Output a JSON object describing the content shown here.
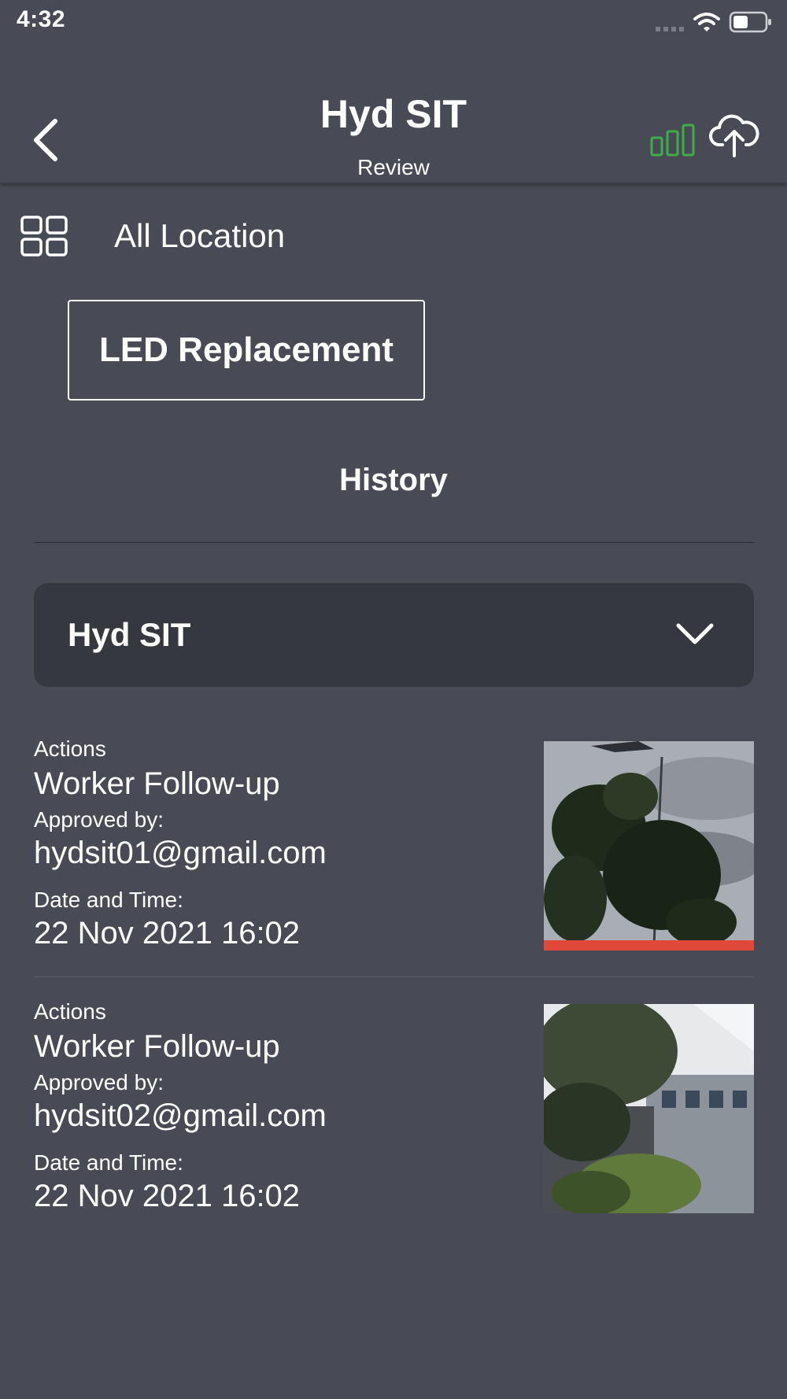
{
  "status_bar": {
    "time": "4:32"
  },
  "header": {
    "title": "Hyd SIT",
    "subtitle": "Review"
  },
  "location": {
    "label": "All Location"
  },
  "category": {
    "label": "LED Replacement"
  },
  "history": {
    "title": "History",
    "dropdown": {
      "selected": "Hyd SIT"
    },
    "items": [
      {
        "actions_label": "Actions",
        "action": "Worker Follow-up",
        "approved_label": "Approved by:",
        "approver": "hydsit01@gmail.com",
        "datetime_label": "Date and Time:",
        "datetime": "22 Nov 2021 16:02"
      },
      {
        "actions_label": "Actions",
        "action": "Worker Follow-up",
        "approved_label": "Approved by:",
        "approver": "hydsit02@gmail.com",
        "datetime_label": "Date and Time:",
        "datetime": "22 Nov 2021 16:02"
      }
    ]
  },
  "colors": {
    "background": "#484a56",
    "dropdown": "#363840",
    "signal_green": "#3fae49"
  },
  "icons": [
    "back-chevron-icon",
    "signal-bars-icon",
    "upload-cloud-icon",
    "grid-icon",
    "chevron-down-icon",
    "wifi-icon",
    "battery-icon"
  ]
}
